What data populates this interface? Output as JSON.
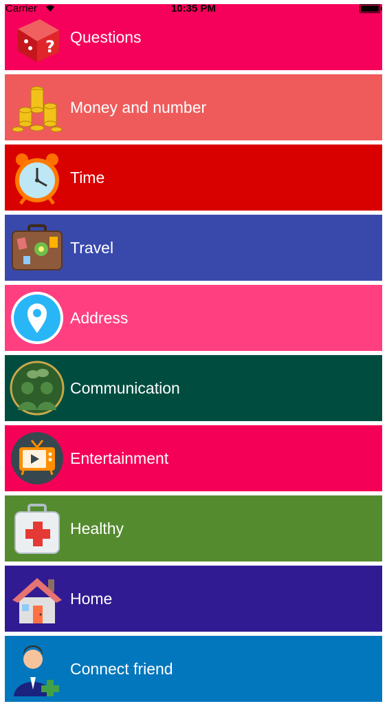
{
  "status_bar": {
    "carrier": "Carrier",
    "time": "10:35 PM"
  },
  "menu": {
    "items": [
      {
        "label": "Questions",
        "color": "#f5005a",
        "icon": "question-dice-icon"
      },
      {
        "label": "Money and number",
        "color": "#ef5b5b",
        "icon": "coins-icon"
      },
      {
        "label": "Time",
        "color": "#d90000",
        "icon": "alarm-clock-icon"
      },
      {
        "label": "Travel",
        "color": "#3949ab",
        "icon": "suitcase-icon"
      },
      {
        "label": "Address",
        "color": "#ff3f7f",
        "icon": "location-pin-icon"
      },
      {
        "label": "Communication",
        "color": "#004d40",
        "icon": "people-chat-icon"
      },
      {
        "label": "Entertainment",
        "color": "#f50057",
        "icon": "tv-play-icon"
      },
      {
        "label": "Healthy",
        "color": "#558b2f",
        "icon": "first-aid-kit-icon"
      },
      {
        "label": "Home",
        "color": "#311b92",
        "icon": "house-icon"
      },
      {
        "label": "Connect friend",
        "color": "#0277bd",
        "icon": "add-friend-icon"
      }
    ]
  }
}
